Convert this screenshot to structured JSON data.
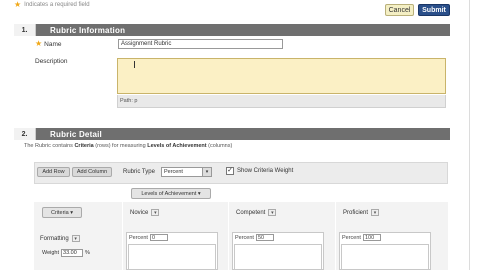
{
  "header": {
    "required_note": "Indicates a required field",
    "cancel_label": "Cancel",
    "submit_label": "Submit"
  },
  "section1": {
    "number": "1.",
    "title": "Rubric Information",
    "name_label": "Name",
    "name_value": "Assignment Rubric",
    "description_label": "Description",
    "description_value": "",
    "editor_path": "Path: p"
  },
  "section2": {
    "number": "2.",
    "title": "Rubric Detail",
    "intro_prefix": "The Rubric contains ",
    "intro_criteria": "Criteria",
    "intro_mid": " (rows) for measuring ",
    "intro_levels": "Levels of Achievement",
    "intro_suffix": " (columns)"
  },
  "toolbar": {
    "add_row": "Add Row",
    "add_column": "Add Column",
    "rubric_type_label": "Rubric Type",
    "rubric_type_value": "Percent",
    "show_weight_checked": true,
    "show_weight_label": "Show Criteria Weight",
    "levels_button": "Levels of Achievement"
  },
  "grid": {
    "criteria_button": "Criteria",
    "columns": [
      {
        "name": "Novice",
        "percent_label": "Percent",
        "percent_value": "0"
      },
      {
        "name": "Competent",
        "percent_label": "Percent",
        "percent_value": "50"
      },
      {
        "name": "Proficient",
        "percent_label": "Percent",
        "percent_value": "100"
      }
    ],
    "rows": [
      {
        "name": "Formatting",
        "weight_label": "Weight",
        "weight_value": "33.00",
        "weight_unit": "%"
      }
    ]
  }
}
